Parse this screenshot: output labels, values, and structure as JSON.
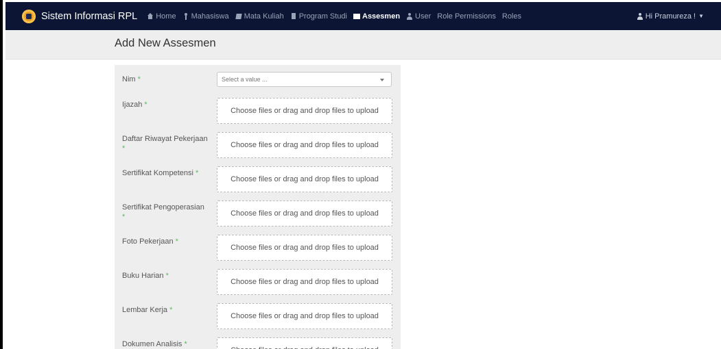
{
  "navbar": {
    "brand": "Sistem Informasi RPL",
    "items": [
      {
        "label": "Home",
        "icon": "home-icon"
      },
      {
        "label": "Mahasiswa",
        "icon": "graduate-icon"
      },
      {
        "label": "Mata Kuliah",
        "icon": "book-icon"
      },
      {
        "label": "Program Studi",
        "icon": "bookmark-icon"
      },
      {
        "label": "Assesmen",
        "icon": "table-icon"
      },
      {
        "label": "User",
        "icon": "user-icon"
      },
      {
        "label": "Role Permissions"
      },
      {
        "label": "Roles"
      }
    ],
    "active_item": "Assesmen",
    "user_greeting": "Hi Pramureza !"
  },
  "page": {
    "title": "Add New Assesmen"
  },
  "form": {
    "nim": {
      "label": "Nim",
      "placeholder": "Select a value ..."
    },
    "upload_text": "Choose files or drag and drop files to upload",
    "required_mark": "*",
    "fields": [
      {
        "label": "Ijazah"
      },
      {
        "label": "Daftar Riwayat Pekerjaan"
      },
      {
        "label": "Sertifikat Kompetensi"
      },
      {
        "label": "Sertifikat Pengoperasian"
      },
      {
        "label": "Foto Pekerjaan"
      },
      {
        "label": "Buku Harian"
      },
      {
        "label": "Lembar Kerja"
      },
      {
        "label": "Dokumen Analisis"
      }
    ]
  },
  "colors": {
    "navbar_bg": "#0c1634",
    "required": "#5cb85c",
    "panel_bg": "#eeeeee"
  }
}
